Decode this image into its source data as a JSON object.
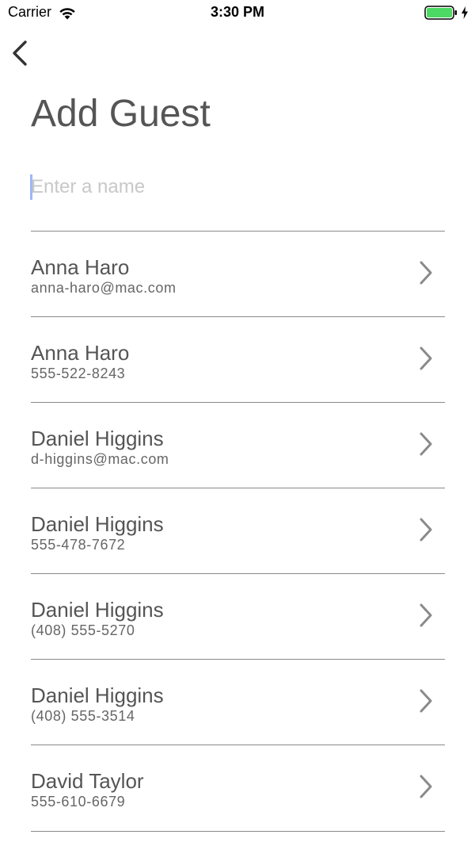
{
  "status_bar": {
    "carrier": "Carrier",
    "time": "3:30 PM",
    "wifi_icon": "wifi-icon",
    "battery_icon": "battery-icon",
    "battery_color": "#4cd964"
  },
  "nav": {
    "back_icon": "chevron-left-icon"
  },
  "page": {
    "title": "Add Guest"
  },
  "search": {
    "placeholder": "Enter a name",
    "value": ""
  },
  "contacts": [
    {
      "name": "Anna Haro",
      "detail": "anna-haro@mac.com"
    },
    {
      "name": "Anna Haro",
      "detail": "555-522-8243"
    },
    {
      "name": "Daniel Higgins",
      "detail": "d-higgins@mac.com"
    },
    {
      "name": "Daniel Higgins",
      "detail": "555-478-7672"
    },
    {
      "name": "Daniel Higgins",
      "detail": "(408) 555-5270"
    },
    {
      "name": "Daniel Higgins",
      "detail": "(408) 555-3514"
    },
    {
      "name": "David Taylor",
      "detail": "555-610-6679"
    }
  ],
  "colors": {
    "text": "#555555",
    "divider": "#8a8a8a",
    "placeholder": "#c8c8c8",
    "caret": "#9bb7f5"
  }
}
